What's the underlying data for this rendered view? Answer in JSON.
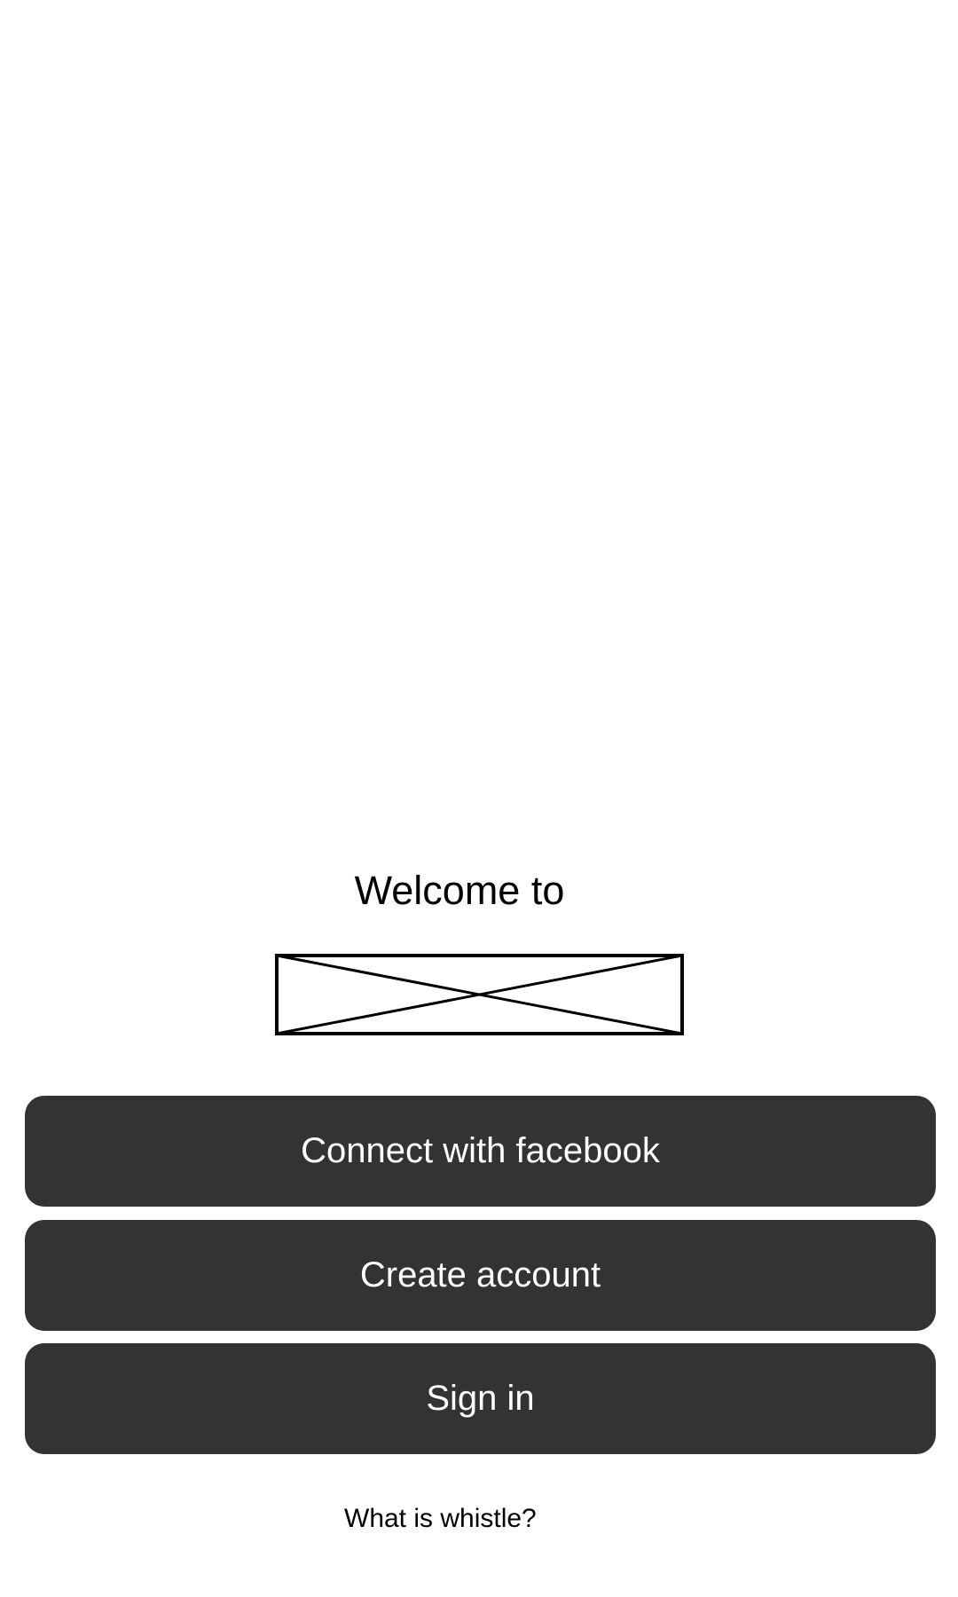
{
  "welcome_text": "Welcome to",
  "logo": {
    "icon": "image-placeholder-icon"
  },
  "buttons": {
    "facebook": "Connect with facebook",
    "create_account": "Create account",
    "sign_in": "Sign in"
  },
  "links": {
    "what_is": "What is whistle?"
  },
  "colors": {
    "button_bg": "#333333",
    "button_text": "#ffffff"
  }
}
